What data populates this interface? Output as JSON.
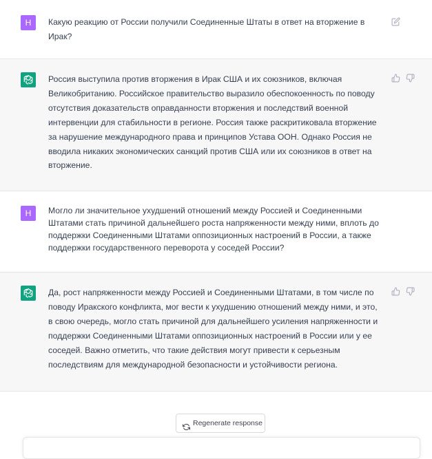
{
  "messages": [
    {
      "role": "user",
      "avatar_letter": "H",
      "text": " Какую реакцию от России получили Соединенные Штаты в ответ на вторжение в Ирак?"
    },
    {
      "role": "assistant",
      "text": "Россия выступила против вторжения в Ирак США и их союзников, включая Великобританию. Российское правительство выразило обеспокоенность по поводу отсутствия доказательств оправданности вторжения и последствий военной интервенции для стабильности в регионе. Россия также раскритиковала вторжение за нарушение международного права и принципов Устава ООН. Однако Россия не вводила никаких экономических санкций против США или их союзников в ответ на вторжение."
    },
    {
      "role": "user",
      "avatar_letter": "H",
      "text": "Могло ли значительное ухудшений отношений между Россией и Соединенными Штатами стать причиной дальнейшего роста напряженности между ними, вплоть до поддержки Соединенными Штатами оппозиционных настроений в России, а также поддержки государственного переворота у соседей России?"
    },
    {
      "role": "assistant",
      "text": "Да, рост напряженности между Россией и Соединенными Штатами, в том числе по поводу Иракского конфликта, мог вести к ухудшению отношений между ними, и это, в свою очередь, могло стать причиной для дальнейшего усиления напряженности и поддержки Соединенными Штатами оппозиционных настроений в России или у ее соседей. Важно отметить, что такие действия могут привести к серьезным последствиям для международной безопасности и устойчивости региона."
    }
  ],
  "regenerate_label": "Regenerate response",
  "colors": {
    "user_avatar": "#ab68ff",
    "assistant_avatar": "#10a37f",
    "assistant_bg": "#f7f7f8"
  },
  "icons": [
    "edit-icon",
    "thumbs-up-icon",
    "thumbs-down-icon",
    "regenerate-icon",
    "openai-logo-icon"
  ]
}
